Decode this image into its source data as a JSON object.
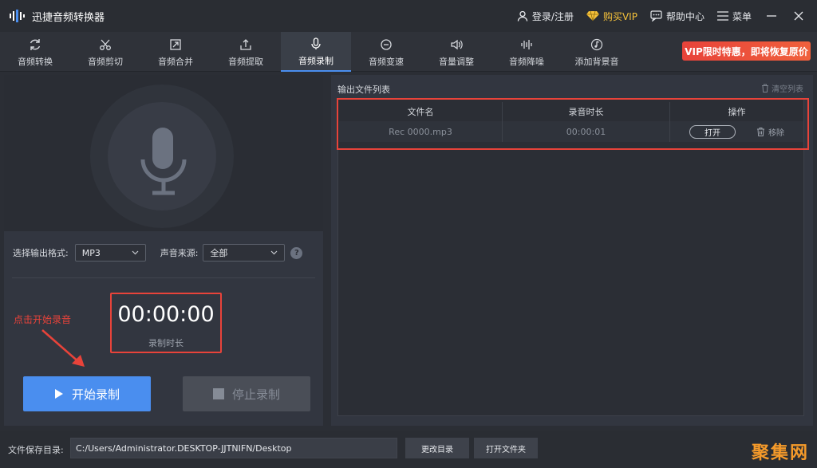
{
  "app": {
    "title": "迅捷音频转换器"
  },
  "header": {
    "login": "登录/注册",
    "buy_vip": "购买VIP",
    "help": "帮助中心",
    "menu": "菜单"
  },
  "tools": [
    {
      "label": "音频转换",
      "icon": "refresh-icon"
    },
    {
      "label": "音频剪切",
      "icon": "scissors-icon"
    },
    {
      "label": "音频合并",
      "icon": "merge-icon"
    },
    {
      "label": "音频提取",
      "icon": "extract-icon"
    },
    {
      "label": "音频录制",
      "icon": "microphone-icon",
      "active": true
    },
    {
      "label": "音频变速",
      "icon": "speed-icon"
    },
    {
      "label": "音量调整",
      "icon": "volume-icon"
    },
    {
      "label": "音频降噪",
      "icon": "noise-reduction-icon"
    },
    {
      "label": "添加背景音",
      "icon": "music-note-icon"
    }
  ],
  "vip_banner": "VIP限时特惠，即将恢复原价",
  "recorder": {
    "format_label": "选择输出格式:",
    "format_value": "MP3",
    "source_label": "声音来源:",
    "source_value": "全部",
    "help_symbol": "?",
    "hint": "点击开始录音",
    "timer": "00:00:00",
    "timer_label": "录制时长",
    "start_label": "开始录制",
    "stop_label": "停止录制"
  },
  "output": {
    "title": "输出文件列表",
    "clear": "清空列表",
    "columns": [
      "文件名",
      "录音时长",
      "操作"
    ],
    "rows": [
      {
        "name": "Rec 0000.mp3",
        "duration": "00:00:01",
        "open": "打开",
        "remove": "移除"
      }
    ]
  },
  "footer": {
    "save_label": "文件保存目录:",
    "path": "C:/Users/Administrator.DESKTOP-JJTNIFN/Desktop",
    "change_dir": "更改目录",
    "open_folder": "打开文件夹",
    "watermark": "聚集网"
  },
  "colors": {
    "accent": "#4a8eef",
    "highlight": "#e8433a",
    "vip": "#f6c23a"
  }
}
